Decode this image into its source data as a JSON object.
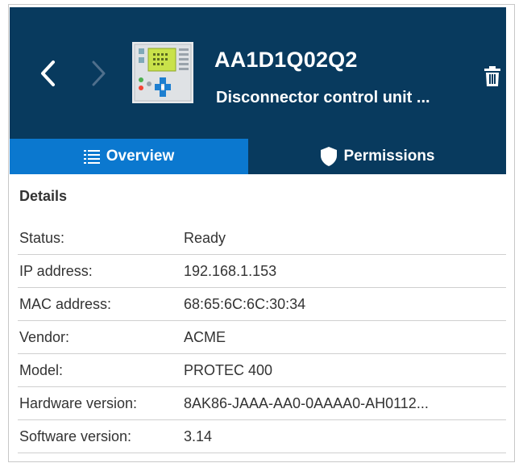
{
  "header": {
    "title": "AA1D1Q02Q2",
    "subtitle": "Disconnector control unit ...",
    "icons": {
      "back": "chevron-left-icon",
      "forward": "chevron-right-icon",
      "device": "protection-relay-device-icon",
      "delete": "trash-icon"
    }
  },
  "tabs": [
    {
      "label": "Overview",
      "icon": "list-icon",
      "active": true
    },
    {
      "label": "Permissions",
      "icon": "shield-icon",
      "active": false
    }
  ],
  "details": {
    "heading": "Details",
    "rows": [
      {
        "label": "Status:",
        "value": "Ready"
      },
      {
        "label": "IP address:",
        "value": "192.168.1.153"
      },
      {
        "label": "MAC address:",
        "value": "68:65:6C:6C:30:34"
      },
      {
        "label": "Vendor:",
        "value": "ACME"
      },
      {
        "label": "Model:",
        "value": "PROTEC 400"
      },
      {
        "label": "Hardware version:",
        "value": "8AK86-JAAA-AA0-0AAAA0-AH0112..."
      },
      {
        "label": "Software version:",
        "value": "3.14"
      }
    ]
  },
  "colors": {
    "header_bg": "#083a5e",
    "active_tab": "#0b78cf",
    "text": "#333333"
  }
}
